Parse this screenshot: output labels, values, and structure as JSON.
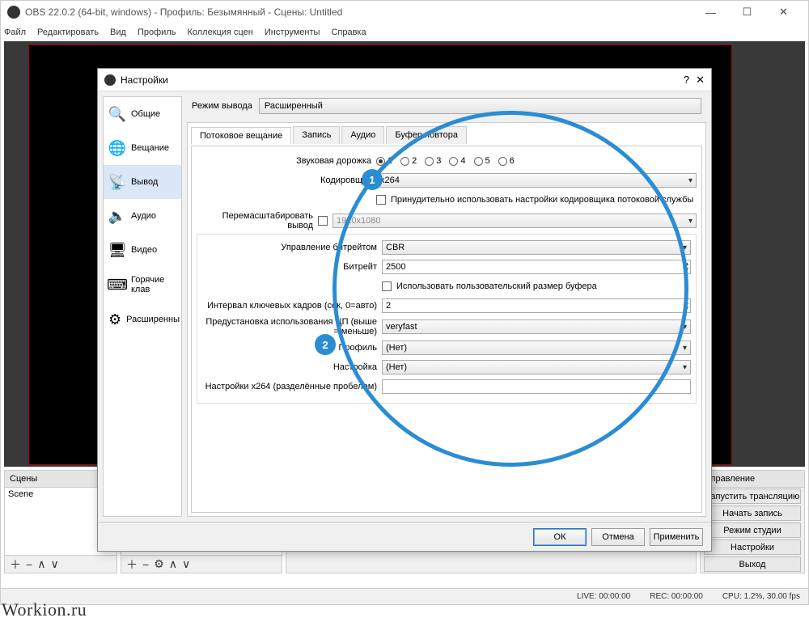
{
  "window": {
    "title": "OBS 22.0.2 (64-bit, windows) - Профиль: Безымянный - Сцены: Untitled",
    "menu": [
      "Файл",
      "Редактировать",
      "Вид",
      "Профиль",
      "Коллекция сцен",
      "Инструменты",
      "Справка"
    ]
  },
  "docks": {
    "scenes_header": "Сцены",
    "scene_item": "Scene",
    "controls_header": "Управление",
    "controls": {
      "start_stream": "Запустить трансляцию",
      "start_record": "Начать запись",
      "studio_mode": "Режим студии",
      "settings": "Настройки",
      "exit": "Выход"
    }
  },
  "statusbar": {
    "live": "LIVE: 00:00:00",
    "rec": "REC: 00:00:00",
    "cpu": "CPU: 1.2%, 30.00 fps"
  },
  "dialog": {
    "title": "Настройки",
    "sidebar": {
      "general": "Общие",
      "stream": "Вещание",
      "output": "Вывод",
      "audio": "Аудио",
      "video": "Видео",
      "hotkeys": "Горячие клав",
      "advanced": "Расширенны"
    },
    "mode_label": "Режим вывода",
    "mode_value": "Расширенный",
    "tabs": {
      "streaming": "Потоковое вещание",
      "recording": "Запись",
      "audio": "Аудио",
      "replay": "Буфер повтора"
    },
    "fields": {
      "audio_track": "Звуковая дорожка",
      "encoder": "Кодировщик",
      "encoder_value": "x264",
      "enforce": "Принудительно использовать настройки кодировщика потоковой службы",
      "rescale": "Перемасштабировать вывод",
      "rescale_value": "1920x1080",
      "rate_control": "Управление битрейтом",
      "rate_control_value": "CBR",
      "bitrate": "Битрейт",
      "bitrate_value": "2500",
      "custom_buffer": "Использовать пользовательский размер буфера",
      "keyframe": "Интервал ключевых кадров (сек, 0=авто)",
      "keyframe_value": "2",
      "cpu_preset": "Предустановка использования ЦП (выше = меньше)",
      "cpu_preset_value": "veryfast",
      "profile": "Профиль",
      "profile_value": "(Нет)",
      "tune": "Настройка",
      "tune_value": "(Нет)",
      "x264opts": "Настройки x264 (разделённые пробелом)"
    },
    "buttons": {
      "ok": "ОК",
      "cancel": "Отмена",
      "apply": "Применить"
    }
  },
  "callouts": {
    "b1": "1",
    "b2": "2"
  },
  "watermark": "Workion.ru"
}
